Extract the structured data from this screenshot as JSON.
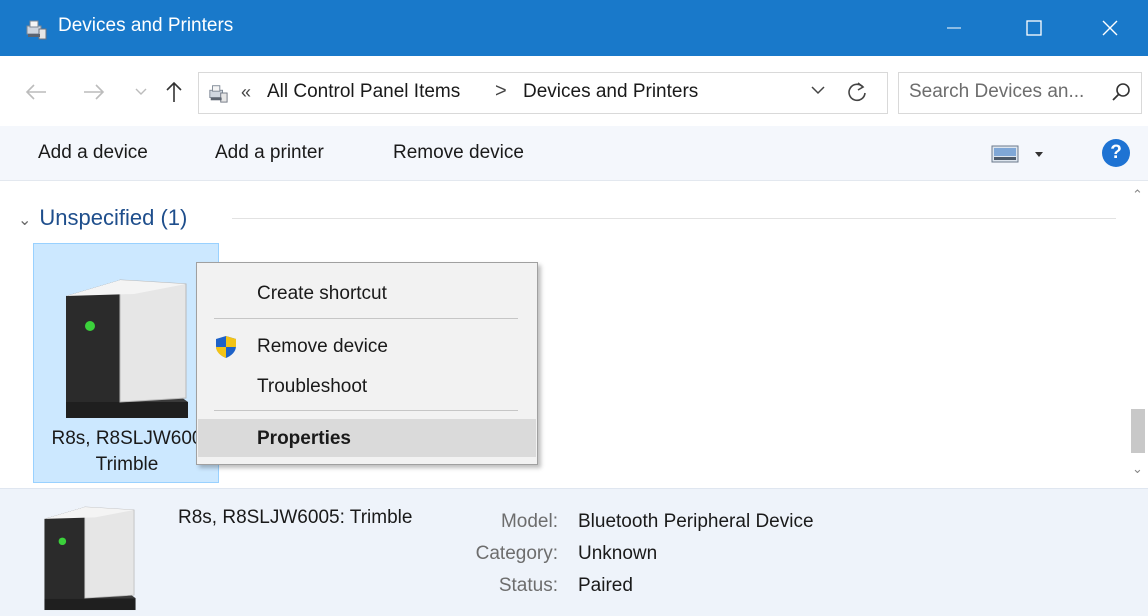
{
  "window": {
    "title": "Devices and Printers"
  },
  "address": {
    "overflow": "«",
    "crumbs": [
      "All Control Panel Items",
      "Devices and Printers"
    ],
    "separator": ">"
  },
  "search": {
    "placeholder": "Search Devices an..."
  },
  "toolbar": {
    "add_device": "Add a device",
    "add_printer": "Add a printer",
    "remove_device": "Remove device",
    "help": "?"
  },
  "group": {
    "label": "Unspecified (1)"
  },
  "device": {
    "line1": "R8s, R8SLJW600",
    "line2": "Trimble"
  },
  "context_menu": {
    "items": [
      "Create shortcut",
      "Remove device",
      "Troubleshoot",
      "Properties"
    ]
  },
  "details": {
    "name": "R8s, R8SLJW6005: Trimble",
    "model_label": "Model:",
    "model": "Bluetooth Peripheral Device",
    "category_label": "Category:",
    "category": "Unknown",
    "status_label": "Status:",
    "status": "Paired"
  },
  "icons": {
    "back": "back-arrow-icon",
    "forward": "forward-arrow-icon",
    "recent": "recent-locations-icon",
    "up": "up-arrow-icon",
    "refresh": "refresh-icon",
    "search": "search-icon",
    "shield": "uac-shield-icon",
    "device": "generic-device-icon"
  },
  "colors": {
    "titlebar": "#1979ca",
    "selection": "#cce8ff",
    "group": "#1e4e8c",
    "help": "#1e73d3"
  }
}
